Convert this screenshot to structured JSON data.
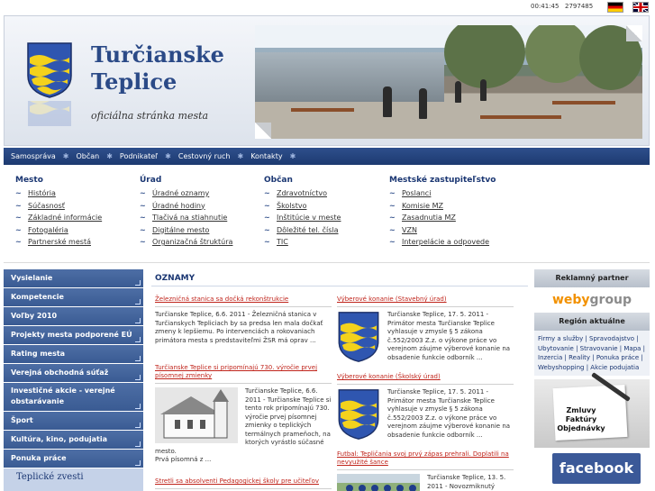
{
  "topbar": {
    "clock": "00:41:45",
    "counter": "2797485"
  },
  "header": {
    "title_line1": "Turčianske",
    "title_line2": "Teplice",
    "subtitle": "oficiálna stránka mesta"
  },
  "nav": {
    "items": [
      "Samospráva",
      "Občan",
      "Podnikateľ",
      "Cestovný ruch",
      "Kontakty"
    ]
  },
  "links": {
    "columns": [
      {
        "title": "Mesto",
        "items": [
          "História",
          "Súčasnosť",
          "Základné informácie",
          "Fotogaléria",
          "Partnerské mestá"
        ]
      },
      {
        "title": "Úrad",
        "items": [
          "Úradné oznamy",
          "Úradné hodiny",
          "Tlačivá na stiahnutie",
          "Digitálne mesto",
          "Organizačná štruktúra"
        ]
      },
      {
        "title": "Občan",
        "items": [
          "Zdravotníctvo",
          "Školstvo",
          "Inštitúcie v meste",
          "Dôležité tel. čísla",
          "TIC"
        ]
      },
      {
        "title": "Mestské zastupiteľstvo",
        "items": [
          "Poslanci",
          "Komisie MZ",
          "Zasadnutia MZ",
          "VZN",
          "Interpelácie a odpovede"
        ]
      }
    ]
  },
  "leftmenu": {
    "items": [
      "Vysielanie",
      "Kompetencie",
      "Voľby 2010",
      "Projekty mesta podporené EÚ",
      "Rating mesta",
      "Verejná obchodná súťaž",
      "Investičné akcie - verejné obstarávanie",
      "Šport",
      "Kultúra, kino, podujatia",
      "Ponuka práce"
    ],
    "zvesti": "Teplické zvesti"
  },
  "center": {
    "heading": "OZNAMY",
    "news": [
      {
        "title": "Železničná stanica sa dočká rekonštrukcie",
        "body": "Turčianske Teplice, 6.6. 2011 - Železničná stanica v Turčianskych Tepliciach by sa predsa len mala dočkať zmeny k lepšiemu. Po intervenciách a rokovaniach primátora mesta s predstaviteľmi ŽSR má oprav ..."
      },
      {
        "title": "Turčianske Teplice si pripomínajú 730. výročie prvej písomnej zmienky",
        "body": "Turčianske Teplice, 6.6. 2011 - Turčianske Teplice si tento rok pripomínajú 730. výročie prvej písomnej zmienky o teplických termálnych prameňoch, na ktorých vyrástlo súčasné mesto.",
        "extra": "Prvá písomná z ..."
      },
      {
        "title": "Stretli sa absolventi Pedagogickej školy pre učiteľov"
      },
      {
        "title": "Výberové konanie (Stavebný úrad)",
        "body": "Turčianske Teplice, 17. 5. 2011 - Primátor mesta Turčianske Teplice vyhlasuje v zmysle § 5 zákona č.552/2003 Z.z. o výkone práce vo verejnom záujme výberové konanie na obsadenie funkcie odborník ..."
      },
      {
        "title": "Výberové konanie (Školský úrad)",
        "body": "Turčianske Teplice, 17. 5. 2011 - Primátor mesta Turčianske Teplice vyhlasuje v zmysle § 5 zákona č.552/2003 Z.z. o výkone práce vo verejnom záujme výberové konanie na obsadenie funkcie odborník ..."
      },
      {
        "title": "Futbal: Tepličania svoj prvý zápas prehrali. Doplatili na nevyužité šance",
        "body": "Turčianske Teplice, 13. 5. 2011 - Novozmiknutý"
      }
    ]
  },
  "right": {
    "partner_heading": "Reklamný partner",
    "partner_logo_a": "weby",
    "partner_logo_b": "group",
    "region_heading": "Región aktuálne",
    "region_links": [
      "Firmy a služby",
      "Spravodajstvo",
      "Ubytovanie",
      "Stravovanie",
      "Mapa",
      "Inzercia",
      "Reality",
      "Ponuka práce",
      "Webyshopping",
      "Akcie podujatia"
    ],
    "faktury": "Zmluvy Faktúry Objednávky",
    "facebook": "facebook"
  },
  "colors": {
    "brand": "#2b4a87",
    "nav": "#1d3a70",
    "news_title": "#c0241b",
    "menu": "#3a5b93"
  }
}
